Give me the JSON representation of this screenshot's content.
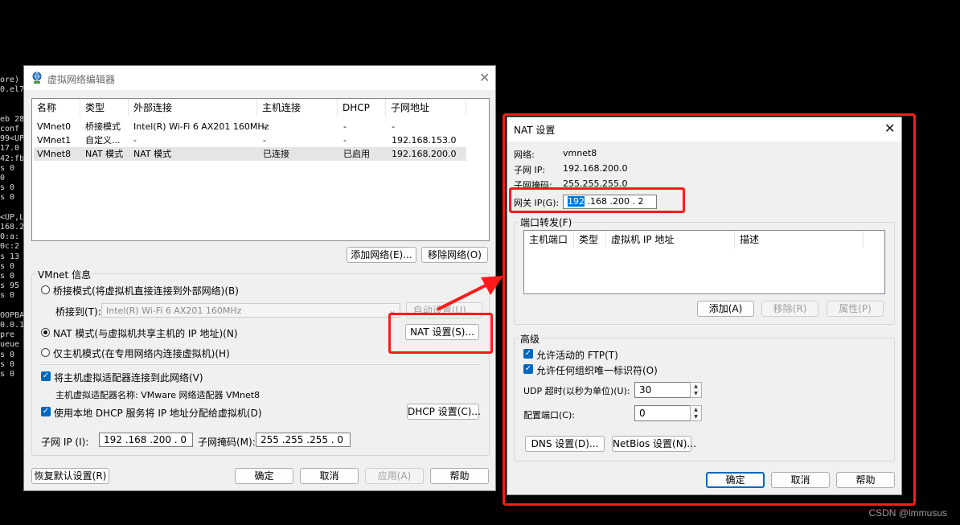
{
  "terminal": {
    "lines": [
      "ore)",
      "0.el7",
      "",
      "",
      "eb 28",
      "conf",
      "99<UP",
      "17.0",
      "42:fb",
      "s 0",
      "0",
      "s 0",
      "s 0",
      "",
      "<UP,L",
      "168.2",
      "0:a:",
      "0c:2",
      "s 13",
      "s 0",
      "s 0",
      "s 95",
      "s 0",
      "",
      "OOPBA",
      "0.0.1",
      "pre",
      "ueue",
      "s 0",
      "s 0",
      "s 0"
    ]
  },
  "watermark": "CSDN @lmmusus",
  "editor": {
    "title": "虚拟网络编辑器",
    "columns": [
      "名称",
      "类型",
      "外部连接",
      "主机连接",
      "DHCP",
      "子网地址"
    ],
    "rows": [
      [
        "VMnet0",
        "桥接模式",
        "Intel(R) Wi-Fi 6 AX201 160MHz",
        "-",
        "-",
        "-"
      ],
      [
        "VMnet1",
        "自定义...",
        "-",
        "-",
        "-",
        "192.168.153.0"
      ],
      [
        "VMnet8",
        "NAT 模式",
        "NAT 模式",
        "已连接",
        "已启用",
        "192.168.200.0"
      ]
    ],
    "add_network": "添加网络(E)...",
    "remove_network": "移除网络(O)",
    "vmnet_info": "VMnet 信息",
    "bridge_mode": "桥接模式(将虚拟机直接连接到外部网络)(B)",
    "bridge_to_label": "桥接到(T):",
    "bridge_to_value": "Intel(R) Wi-Fi 6 AX201 160MHz",
    "auto_settings": "自动设置(U)...",
    "nat_mode": "NAT 模式(与虚拟机共享主机的 IP 地址)(N)",
    "nat_settings": "NAT 设置(S)...",
    "host_only": "仅主机模式(在专用网络内连接虚拟机)(H)",
    "connect_adapter": "将主机虚拟适配器连接到此网络(V)",
    "adapter_name": "主机虚拟适配器名称: VMware 网络适配器 VMnet8",
    "use_dhcp": "使用本地 DHCP 服务将 IP 地址分配给虚拟机(D)",
    "dhcp_settings": "DHCP 设置(C)...",
    "subnet_ip_label": "子网 IP (I):",
    "subnet_ip": "192 .168 .200 .  0",
    "subnet_mask_label": "子网掩码(M):",
    "subnet_mask": "255 .255 .255 .  0",
    "restore_defaults": "恢复默认设置(R)",
    "ok": "确定",
    "cancel": "取消",
    "apply": "应用(A)",
    "help": "帮助"
  },
  "nat": {
    "title": "NAT 设置",
    "network_label": "网络:",
    "network_value": "vmnet8",
    "subnet_ip_label": "子网 IP:",
    "subnet_ip_value": "192.168.200.0",
    "subnet_mask_label": "子网掩码:",
    "subnet_mask_value": "255.255.255.0",
    "gateway_label": "网关 IP(G):",
    "gateway_sel": "192",
    "gateway_rest": " .168 .200 .  2",
    "port_forward": "端口转发(F)",
    "pf_columns": [
      "主机端口",
      "类型",
      "虚拟机 IP 地址",
      "描述"
    ],
    "add": "添加(A)",
    "remove": "移除(R)",
    "properties": "属性(P)",
    "advanced": "高级",
    "allow_ftp": "允许活动的 FTP(T)",
    "allow_oui": "允许任何组织唯一标识符(O)",
    "udp_timeout_label": "UDP 超时(以秒为单位)(U):",
    "udp_timeout": "30",
    "config_port_label": "配置端口(C):",
    "config_port": "0",
    "dns_settings": "DNS 设置(D)...",
    "netbios_settings": "NetBios 设置(N)...",
    "ok": "确定",
    "cancel": "取消",
    "help": "帮助"
  },
  "colors": {
    "highlight": "#ff1a1a",
    "accent": "#0067c0"
  }
}
